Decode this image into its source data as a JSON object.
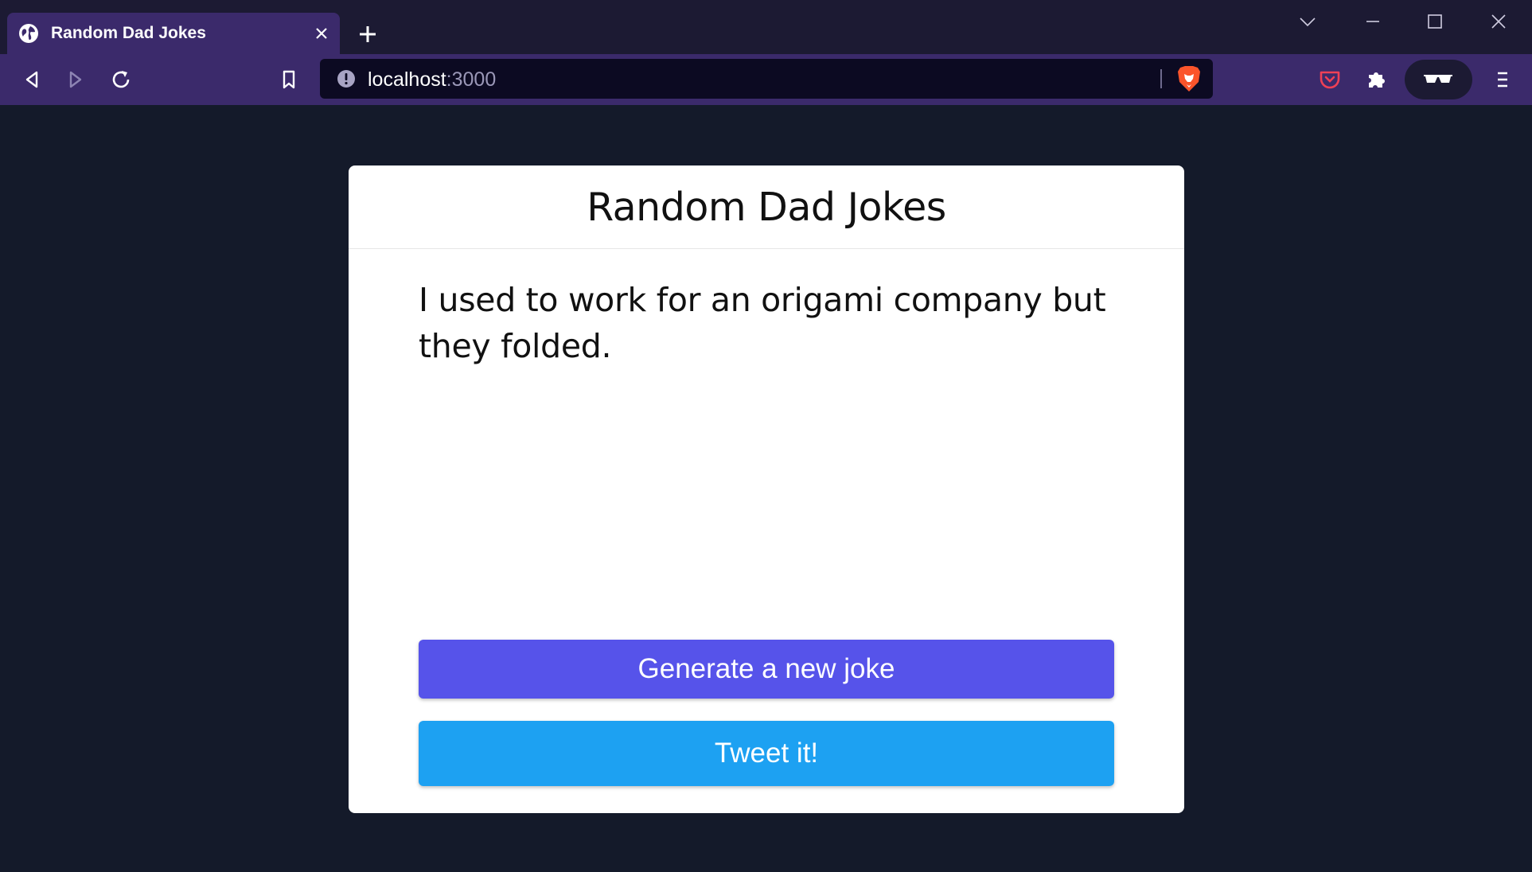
{
  "browser": {
    "tab": {
      "title": "Random Dad Jokes"
    },
    "address_bar": {
      "host": "localhost",
      "port": ":3000"
    }
  },
  "page": {
    "title": "Random Dad Jokes",
    "joke": "I used to work for an origami company but they folded.",
    "buttons": {
      "generate_label": "Generate a new joke",
      "tweet_label": "Tweet it!"
    }
  },
  "icons": {
    "favicon": "globe-icon",
    "tab_close": "close-icon",
    "new_tab": "plus-icon",
    "back": "back-arrow-icon",
    "forward": "forward-arrow-icon",
    "reload": "reload-icon",
    "bookmark": "bookmark-icon",
    "site_info": "info-icon",
    "brave_shields": "brave-lion-icon",
    "pocket": "pocket-icon",
    "extensions": "puzzle-icon",
    "private": "glasses-icon",
    "menu": "hamburger-menu-icon"
  },
  "colors": {
    "page_background": "#141a2a",
    "toolbar": "#3b2a6b",
    "generate_button": "#5653ea",
    "tweet_button": "#1da1f2",
    "brave_orange": "#fb542b",
    "pocket_red": "#ef4056"
  }
}
